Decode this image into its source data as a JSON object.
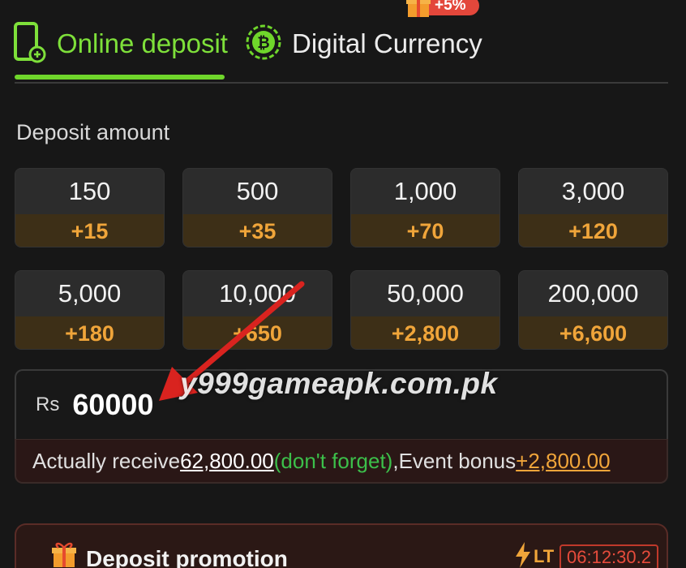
{
  "tabs": [
    {
      "label": "Online deposit",
      "active": true,
      "icon": "phone-icon"
    },
    {
      "label": "Digital Currency",
      "active": false,
      "icon": "bitcoin-icon"
    }
  ],
  "promo_badge": {
    "text": "+5%",
    "icon": "gift-icon"
  },
  "deposit_label": "Deposit amount",
  "amounts": [
    {
      "amount": "150",
      "bonus": "+15"
    },
    {
      "amount": "500",
      "bonus": "+35"
    },
    {
      "amount": "1,000",
      "bonus": "+70"
    },
    {
      "amount": "3,000",
      "bonus": "+120"
    },
    {
      "amount": "5,000",
      "bonus": "+180"
    },
    {
      "amount": "10,000",
      "bonus": "+650"
    },
    {
      "amount": "50,000",
      "bonus": "+2,800"
    },
    {
      "amount": "200,000",
      "bonus": "+6,600"
    }
  ],
  "input": {
    "currency": "Rs",
    "value": "60000"
  },
  "receive": {
    "label": "Actually receive",
    "amount": "62,800.00",
    "note": "(don't forget)",
    "separator": ",",
    "bonus_label": "Event bonus",
    "bonus_amount": "+2,800.00"
  },
  "watermark": "y999gameapk.com.pk",
  "promotion": {
    "title": "Deposit promotion",
    "badge": "LT",
    "timer": "06:12:30.2"
  },
  "colors": {
    "accent_green": "#6fd62b",
    "bonus_orange": "#f0a53a",
    "note_green": "#3cbf4a",
    "alert_red": "#e74c3c"
  }
}
